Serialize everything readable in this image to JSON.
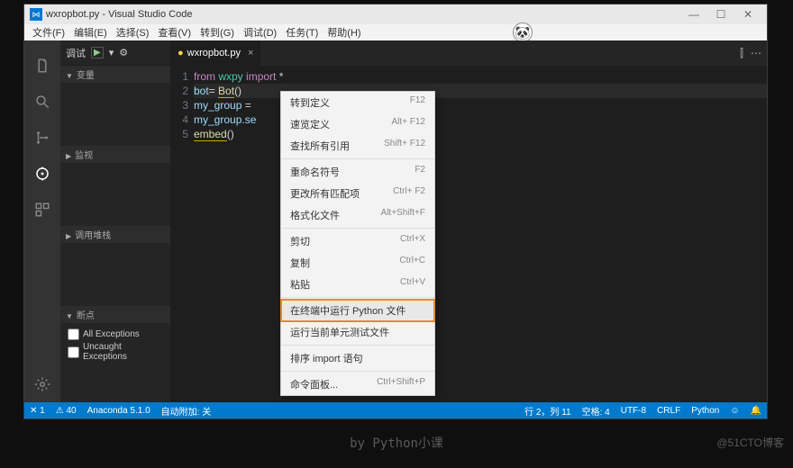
{
  "title": "wxropbot.py - Visual Studio Code",
  "menu": [
    "文件(F)",
    "编辑(E)",
    "选择(S)",
    "查看(V)",
    "转到(G)",
    "调试(D)",
    "任务(T)",
    "帮助(H)"
  ],
  "avatar_emoji": "🐼",
  "debug": {
    "label": "调试",
    "play": "▶",
    "gear": "⚙"
  },
  "sections": {
    "vars": "变量",
    "watch": "监视",
    "stack": "调用堆栈",
    "breakpoints": "断点"
  },
  "exceptions": {
    "all": "All Exceptions",
    "uncaught": "Uncaught Exceptions"
  },
  "tab": {
    "filename": "wxropbot.py",
    "close": "×"
  },
  "tabactions": {
    "split": "⫿",
    "more": "⋯"
  },
  "code": {
    "line_numbers": [
      "1",
      "2",
      "3",
      "4",
      "5"
    ],
    "l1": {
      "a": "from",
      "b": "wxpy",
      "c": "import",
      "d": "*"
    },
    "l2": {
      "a": "bot",
      "b": "=",
      "c": "Bot",
      "d": "()"
    },
    "l3": {
      "a": "my_group",
      "b": "="
    },
    "l4": {
      "a": "my_group",
      "b": ".",
      "c": "se"
    },
    "l5": {
      "a": "embed",
      "b": "()"
    }
  },
  "contextmenu": [
    {
      "label": "转到定义",
      "sc": "F12"
    },
    {
      "label": "速览定义",
      "sc": "Alt+ F12"
    },
    {
      "label": "查找所有引用",
      "sc": "Shift+ F12"
    },
    {
      "sep": true
    },
    {
      "label": "重命名符号",
      "sc": "F2"
    },
    {
      "label": "更改所有匹配项",
      "sc": "Ctrl+ F2"
    },
    {
      "label": "格式化文件",
      "sc": "Alt+Shift+F"
    },
    {
      "sep": true
    },
    {
      "label": "剪切",
      "sc": "Ctrl+X"
    },
    {
      "label": "复制",
      "sc": "Ctrl+C"
    },
    {
      "label": "粘贴",
      "sc": "Ctrl+V"
    },
    {
      "sep": true
    },
    {
      "label": "在终端中运行 Python 文件",
      "sc": "",
      "hl": true
    },
    {
      "label": "运行当前单元测试文件",
      "sc": ""
    },
    {
      "sep": true
    },
    {
      "label": "排序 import 语句",
      "sc": ""
    },
    {
      "sep": true
    },
    {
      "label": "命令面板...",
      "sc": "Ctrl+Shift+P"
    }
  ],
  "status": {
    "err": "✕ 1",
    "warn": "⚠ 40",
    "env": "Anaconda 5.1.0",
    "indent": "自动附加: 关",
    "ln": "行 2，列 11",
    "spaces": "空格: 4",
    "enc": "UTF-8",
    "eol": "CRLF",
    "lang": "Python",
    "smile": "☺",
    "bell": "🔔"
  },
  "watermark": "by Python小课",
  "watermark2": "@51CTO博客"
}
